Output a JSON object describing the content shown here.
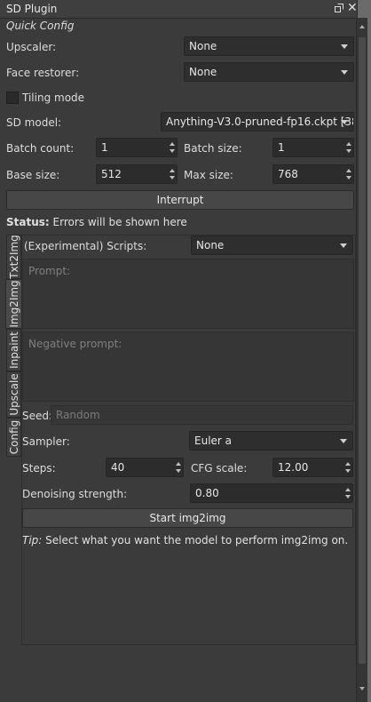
{
  "window": {
    "title": "SD Plugin"
  },
  "quick_config": {
    "heading": "Quick Config",
    "upscaler_label": "Upscaler:",
    "upscaler_value": "None",
    "face_restorer_label": "Face restorer:",
    "face_restorer_value": "None",
    "tiling_label": "Tiling mode",
    "sd_model_label": "SD model:",
    "sd_model_value": "Anything-V3.0-pruned-fp16.ckpt [38",
    "batch_count_label": "Batch count:",
    "batch_count_value": "1",
    "batch_size_label": "Batch size:",
    "batch_size_value": "1",
    "base_size_label": "Base size:",
    "base_size_value": "512",
    "max_size_label": "Max size:",
    "max_size_value": "768",
    "interrupt_label": "Interrupt",
    "status_label": "Status:",
    "status_text": "Errors will be shown here"
  },
  "tabs": [
    "Txt2Img",
    "Img2Img",
    "Inpaint",
    "Upscale",
    "Config"
  ],
  "active_tab": "Img2Img",
  "img2img": {
    "scripts_label": "(Experimental) Scripts:",
    "scripts_value": "None",
    "prompt_placeholder": "Prompt:",
    "negative_placeholder": "Negative prompt:",
    "seed_label": "Seed:",
    "seed_placeholder": "Random",
    "sampler_label": "Sampler:",
    "sampler_value": "Euler a",
    "steps_label": "Steps:",
    "steps_value": "40",
    "cfg_label": "CFG scale:",
    "cfg_value": "12.00",
    "denoise_label": "Denoising strength:",
    "denoise_value": "0.80",
    "start_label": "Start img2img",
    "tip_label": "Tip:",
    "tip_text": "Select what you want the model to perform img2img on."
  },
  "colors": {
    "panel_bg": "#3b3b3b",
    "field_bg": "#2e2e2e",
    "button_bg": "#474747"
  }
}
